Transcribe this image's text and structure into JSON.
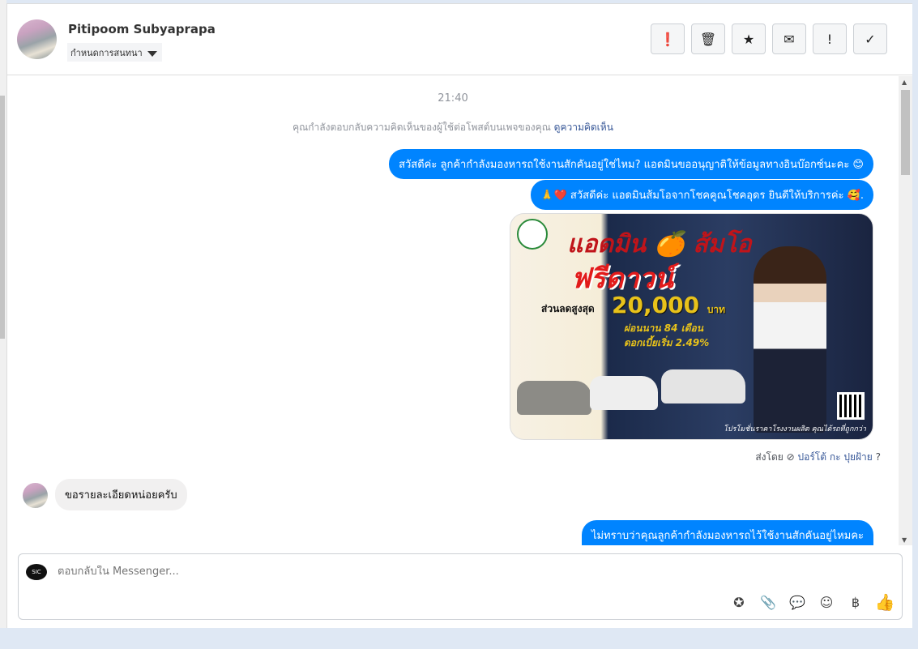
{
  "header": {
    "name": "Pitipoom Subyaprapa",
    "assign_label": "กำหนดการสนทนา"
  },
  "actions": [
    {
      "icon": "alert-circle-icon",
      "glyph": "❗"
    },
    {
      "icon": "trash-icon",
      "glyph": "🗑"
    },
    {
      "icon": "star-icon",
      "glyph": "★"
    },
    {
      "icon": "envelope-icon",
      "glyph": "✉"
    },
    {
      "icon": "exclamation-icon",
      "glyph": "!"
    },
    {
      "icon": "check-icon",
      "glyph": "✓"
    }
  ],
  "chat": {
    "time": "21:40",
    "notice": "คุณกำลังตอบกลับความคิดเห็นของผู้ใช้ต่อโพสต์บนเพจของคุณ",
    "notice_link": "ดูความคิดเห็น",
    "messages": [
      {
        "text": "สวัสดีค่ะ ลูกค้ากำลังมองหารถใช้งานสักคันอยู่ใช่ไหม? แอดมินขออนุญาติให้ข้อมูลทางอินบ๊อกซ์นะคะ 😊"
      },
      {
        "text": "🙏❤️ สวัสดีค่ะ แอดมินส้มโอจากโชคคูณโชคอุดร ยินดีให้บริการค่ะ 🥰."
      },
      {
        "text": "ขอรายละเอียดหน่อยครับ"
      },
      {
        "text": "ไม่ทราบว่าคุณลูกค้ากำลังมองหารถไว้ใช้งานสักคันอยู่ไหมคะ"
      }
    ],
    "ad": {
      "title": "แอดมิน 🍊 ส้มโอ",
      "headline": "ฟรีดาวน์",
      "discount_label": "ส่วนลดสูงสุด",
      "amount": "20,000",
      "currency": "บาท",
      "installment": "ผ่อนนาน 84 เดือน",
      "interest": "ดอกเบี้ยเริ่ม 2.49%",
      "footer": "โปรโมชั่นราคาโรงงานผลิต คุณได้รถที่ถูกกว่า"
    },
    "sent_by_label": "ส่งโดย",
    "sent_by_name": "ปอร์โต้ กะ ปุยฝ้าย"
  },
  "composer": {
    "placeholder": "ตอบกลับใน Messenger...",
    "tools": [
      {
        "icon": "saved-reply-icon",
        "glyph": "✪"
      },
      {
        "icon": "paperclip-icon",
        "glyph": "📎"
      },
      {
        "icon": "chat-bubble-icon",
        "glyph": "💬"
      },
      {
        "icon": "emoji-icon",
        "glyph": "☺"
      },
      {
        "icon": "baht-icon",
        "glyph": "฿"
      },
      {
        "icon": "thumbs-up-icon",
        "glyph": "👍"
      }
    ]
  },
  "colors": {
    "accent": "#0084ff",
    "incoming": "#f1f0f0"
  }
}
